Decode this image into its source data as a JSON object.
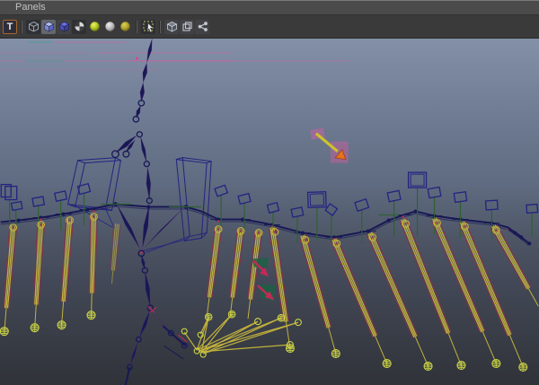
{
  "menubar": {
    "panels_label": "Panels"
  },
  "toolbar": {
    "select_tool_glyph": "T",
    "icons": [
      "select-tool-icon",
      "wireframe-cube-icon",
      "shaded-cube-icon",
      "textured-cube-icon",
      "checkered-sphere-icon",
      "lit-sphere-icon",
      "flat-sphere-icon",
      "olive-sphere-icon",
      "selection-highlight-icon",
      "isolate-cube-icon",
      "duplicate-view-icon",
      "share-view-icon"
    ]
  },
  "viewport": {
    "annotation_arrow": {
      "shape": "arrow-down-right",
      "shaft_color": "#cdc22b",
      "head_color": "#e0751d",
      "halo_color": "#d05fa2"
    }
  },
  "colors": {
    "ui_bar": "#4b4b4b",
    "ui_toolbar": "#3a3a3a",
    "ui_text": "#c2c2c2",
    "bg_top": "#8390a7",
    "bg_mid": "#5f6b80",
    "bg_low": "#3a3e48",
    "bg_bot": "#2f3238",
    "navy": "#232380",
    "skel": "#181855",
    "green": "#2f6133",
    "yellow": "#c2b13d",
    "yellow2": "#cdd645",
    "red_edge": "#8e2d48",
    "crimson": "#c22a55",
    "teal": "#3fa38c",
    "pink": "#d05fa2",
    "arrow_shaft": "#cdc22b",
    "arrow_head": "#e0751d"
  }
}
